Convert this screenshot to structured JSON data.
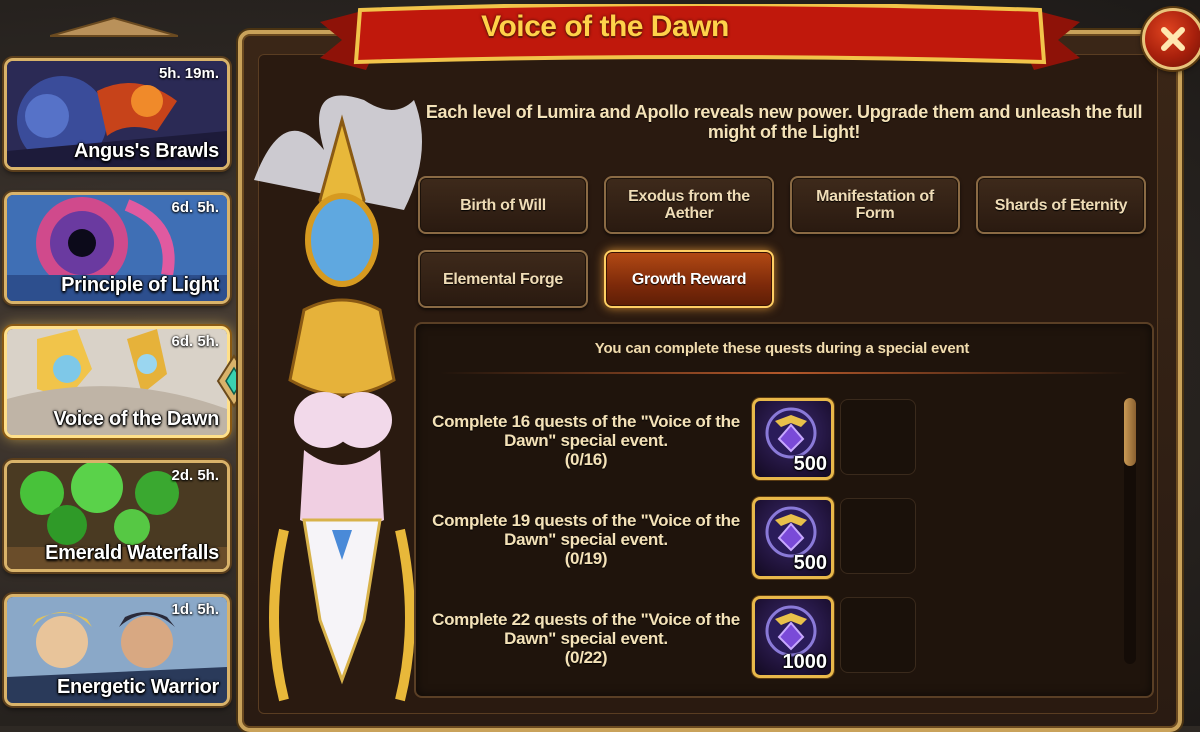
{
  "event_list": [
    {
      "name": "Angus's Brawls",
      "time": "5h. 19m.",
      "active": false
    },
    {
      "name": "Principle of Light",
      "time": "6d. 5h.",
      "active": false
    },
    {
      "name": "Voice of the Dawn",
      "time": "6d. 5h.",
      "active": true
    },
    {
      "name": "Emerald Waterfalls",
      "time": "2d. 5h.",
      "active": false
    },
    {
      "name": "Energetic Warrior",
      "time": "1d. 5h.",
      "active": false
    }
  ],
  "panel": {
    "title": "Voice of the Dawn",
    "description": "Each level of Lumira and Apollo reveals new power. Upgrade them and unleash the full might of the Light!"
  },
  "tabs": [
    {
      "label": "Birth of Will",
      "active": false
    },
    {
      "label": "Exodus from the Aether",
      "active": false
    },
    {
      "label": "Manifestation of Form",
      "active": false
    },
    {
      "label": "Shards of Eternity",
      "active": false
    },
    {
      "label": "Elemental Forge",
      "active": false
    },
    {
      "label": "Growth Reward",
      "active": true
    }
  ],
  "quests": {
    "note": "You can complete these quests during a special event",
    "items": [
      {
        "text": "Complete 16 quests of the \"Voice of the Dawn\" special event.",
        "progress": "(0/16)",
        "reward_qty": "500",
        "reward_icon": "emblem-icon"
      },
      {
        "text": "Complete 19 quests of the \"Voice of the Dawn\" special event.",
        "progress": "(0/19)",
        "reward_qty": "500",
        "reward_icon": "emblem-icon"
      },
      {
        "text": "Complete 22 quests of the \"Voice of the Dawn\" special event.",
        "progress": "(0/22)",
        "reward_qty": "1000",
        "reward_icon": "emblem-icon"
      }
    ]
  },
  "colors": {
    "title": "#ffd24a",
    "banner": "#c0180c",
    "border_gold": "#c9a25a",
    "active_tab": "#b34a14"
  }
}
